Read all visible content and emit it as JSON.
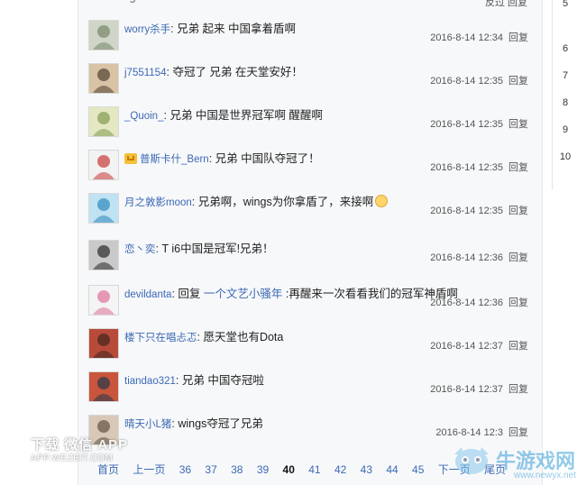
{
  "top_fragments": [
    "5",
    "反过 回复"
  ],
  "replies": [
    {
      "username": "worry杀手",
      "content": "兄弟 起来 中国拿着盾啊",
      "time": "2016-8-14 12:34",
      "reply": "回复",
      "avatar": "avatar-1",
      "colors": [
        "#cfd6c8",
        "#7c8a6e"
      ]
    },
    {
      "username": "j7551154",
      "content": "夺冠了 兄弟 在天堂安好！",
      "time": "2016-8-14 12:35",
      "reply": "回复",
      "avatar": "avatar-2",
      "colors": [
        "#d8c3a5",
        "#5a4a3a"
      ]
    },
    {
      "username": "_Quoin_",
      "content": "兄弟 中国是世界冠军啊 醒醒啊",
      "time": "2016-8-14 12:35",
      "reply": "回复",
      "avatar": "avatar-3",
      "colors": [
        "#e3e8c2",
        "#8aa058"
      ]
    },
    {
      "username": "普斯卡什_Bern",
      "content": "兄弟 中国队夺冠了！",
      "time": "2016-8-14 12:35",
      "reply": "回复",
      "avatar": "avatar-4",
      "vip": true,
      "colors": [
        "#f2f2f2",
        "#c44"
      ]
    },
    {
      "username": "月之敦影moon",
      "content": "兄弟啊，wings为你拿盾了，来接啊",
      "time": "2016-8-14 12:35",
      "reply": "回复",
      "avatar": "avatar-5",
      "emoji": true,
      "colors": [
        "#bfe3f2",
        "#3a8fc2"
      ]
    },
    {
      "username": "恋丶奕",
      "content": "T i6中国是冠军!兄弟！",
      "time": "2016-8-14 12:36",
      "reply": "回复",
      "avatar": "avatar-6",
      "colors": [
        "#c9c9c9",
        "#333"
      ]
    },
    {
      "username": "devildanta",
      "prefix": "回复 ",
      "mention": "一个文艺小骚年",
      "content": "再醒来一次看看我们的冠军神盾啊",
      "time": "2016-8-14 12:36",
      "reply": "回复",
      "avatar": "avatar-7",
      "colors": [
        "#f4f4f4",
        "#e07aa0"
      ]
    },
    {
      "username": "楼下只在唱忐忑",
      "content": "愿天堂也有Dota",
      "time": "2016-8-14 12:37",
      "reply": "回复",
      "avatar": "avatar-8",
      "colors": [
        "#b84a3a",
        "#4a2a20"
      ]
    },
    {
      "username": "tiandao321",
      "content": "兄弟 中国夺冠啦",
      "time": "2016-8-14 12:37",
      "reply": "回复",
      "avatar": "avatar-9",
      "colors": [
        "#c8553c",
        "#2f3b4a"
      ]
    },
    {
      "username": "晴天小L猪",
      "content": "wings夺冠了兄弟",
      "time": "2016-8-14 12:3",
      "reply": "回复",
      "avatar": "avatar-10",
      "colors": [
        "#d8c8b8",
        "#6b5848"
      ]
    }
  ],
  "pager": {
    "first": "首页",
    "prev": "上一页",
    "pages": [
      "36",
      "37",
      "38",
      "39"
    ],
    "current": "40",
    "next_pages": [
      "41",
      "42",
      "43",
      "44",
      "45"
    ],
    "next": "下一页",
    "last": "尾页"
  },
  "right_numbers": [
    "5",
    "6",
    "7",
    "8",
    "9",
    "10"
  ],
  "watermark_left": {
    "title": "下载 微信 APP",
    "url": "APP.WEZEIT.COM"
  },
  "watermark_right": {
    "title": "牛游戏网",
    "url": "www.newyx.net"
  }
}
